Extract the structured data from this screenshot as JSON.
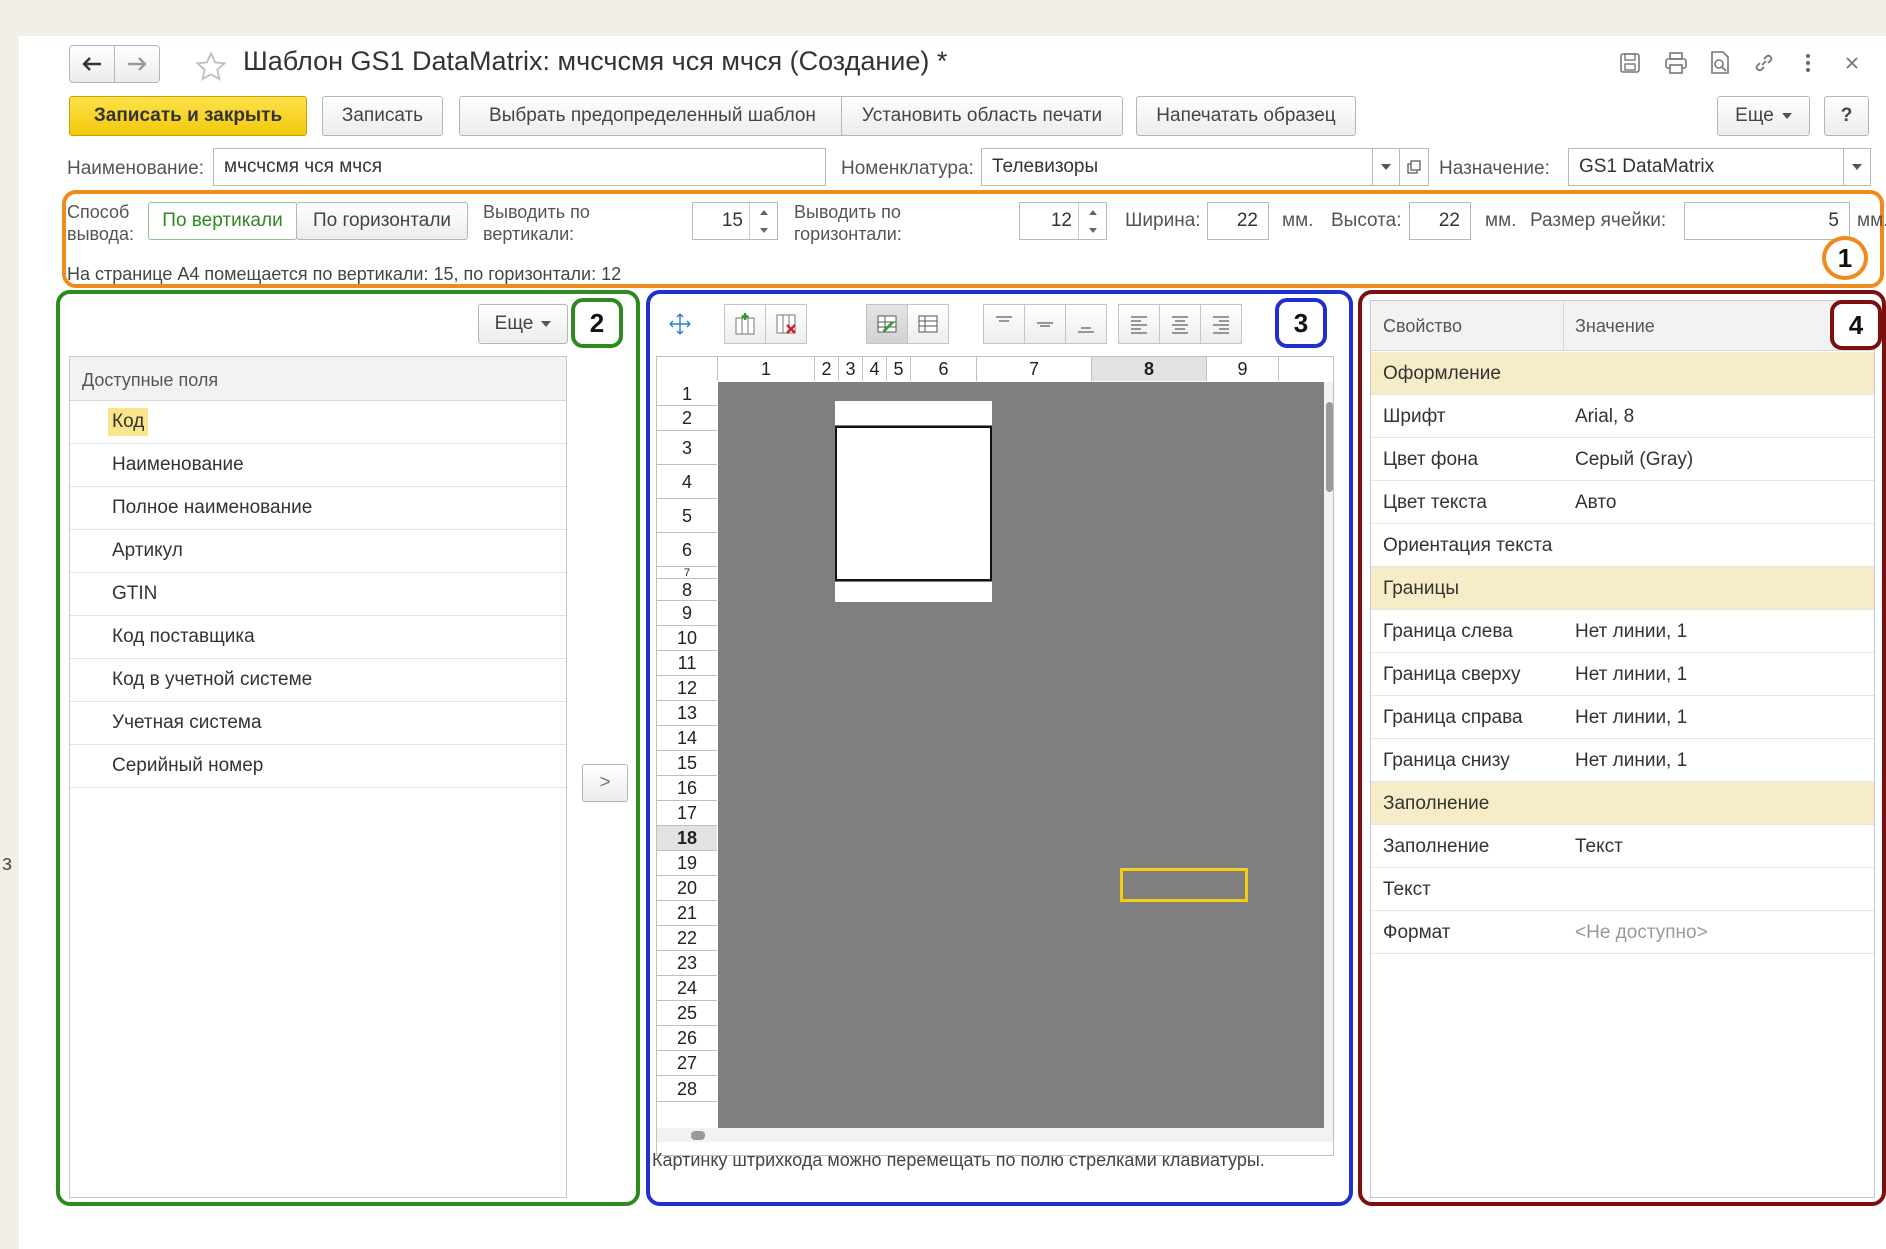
{
  "window": {
    "title": "Шаблон GS1 DataMatrix:  мчсчсмя чся мчся  (Создание) *"
  },
  "toolbar": {
    "save_close": "Записать и закрыть",
    "save": "Записать",
    "choose_template": "Выбрать предопределенный шаблон",
    "set_print_area": "Установить область печати",
    "print_sample": "Напечатать образец",
    "more": "Еще",
    "help": "?"
  },
  "form": {
    "name_label": "Наименование:",
    "name_value": "мчсчсмя чся мчся",
    "nomenclature_label": "Номенклатура:",
    "nomenclature_value": "Телевизоры",
    "purpose_label": "Назначение:",
    "purpose_value": "GS1 DataMatrix"
  },
  "output": {
    "method_label": "Способ вывода:",
    "vertical": "По вертикали",
    "horizontal": "По горизонтали",
    "out_vert_label": "Выводить по вертикали:",
    "out_vert_value": "15",
    "out_horiz_label": "Выводить по горизонтали:",
    "out_horiz_value": "12",
    "width_label": "Ширина:",
    "width_value": "22",
    "height_label": "Высота:",
    "height_value": "22",
    "mm": "мм.",
    "cell_label": "Размер ячейки:",
    "cell_value": "5",
    "info": "На странице А4 помещается по вертикали: 15, по горизонтали: 12"
  },
  "badges": [
    "1",
    "2",
    "3",
    "4"
  ],
  "fields_panel": {
    "more": "Еще",
    "header": "Доступные поля",
    "items": [
      "Код",
      "Наименование",
      "Полное наименование",
      "Артикул",
      "GTIN",
      "Код поставщика",
      "Код в учетной системе",
      "Учетная система",
      "Серийный номер"
    ],
    "move": ">"
  },
  "layout_panel": {
    "columns": [
      "1",
      "2",
      "3",
      "4",
      "5",
      "6",
      "7",
      "8",
      "9"
    ],
    "rows": [
      "1",
      "2",
      "3",
      "4",
      "5",
      "6",
      "7",
      "8",
      "9",
      "10",
      "11",
      "12",
      "13",
      "14",
      "15",
      "16",
      "17",
      "18",
      "19",
      "20",
      "21",
      "22",
      "23",
      "24",
      "25",
      "26",
      "27",
      "28"
    ],
    "hint": "Картинку штрихкода можно перемещать по полю стрелками клавиатуры."
  },
  "properties": {
    "col_property": "Свойство",
    "col_value": "Значение",
    "rows": [
      {
        "key": "Оформление",
        "value": "",
        "group": true
      },
      {
        "key": "Шрифт",
        "value": "Arial, 8"
      },
      {
        "key": "Цвет фона",
        "value": "Серый (Gray)"
      },
      {
        "key": "Цвет текста",
        "value": "Авто"
      },
      {
        "key": "Ориентация текста",
        "value": ""
      },
      {
        "key": "Границы",
        "value": "",
        "group": true
      },
      {
        "key": "Граница слева",
        "value": "Нет линии, 1"
      },
      {
        "key": "Граница сверху",
        "value": "Нет линии, 1"
      },
      {
        "key": "Граница справа",
        "value": "Нет линии, 1"
      },
      {
        "key": "Граница снизу",
        "value": "Нет линии, 1"
      },
      {
        "key": "Заполнение",
        "value": "",
        "group": true
      },
      {
        "key": "Заполнение",
        "value": "Текст"
      },
      {
        "key": "Текст",
        "value": ""
      },
      {
        "key": "Формат",
        "value": "<Не доступно>",
        "muted": true
      }
    ]
  },
  "colors": {
    "orange": "#f08a1c",
    "green": "#2e8a1e",
    "blue": "#1f2fd0",
    "darkred": "#7a1010",
    "accent_yellow": "#f5cc16",
    "gray_canvas": "#7f7f7f"
  }
}
